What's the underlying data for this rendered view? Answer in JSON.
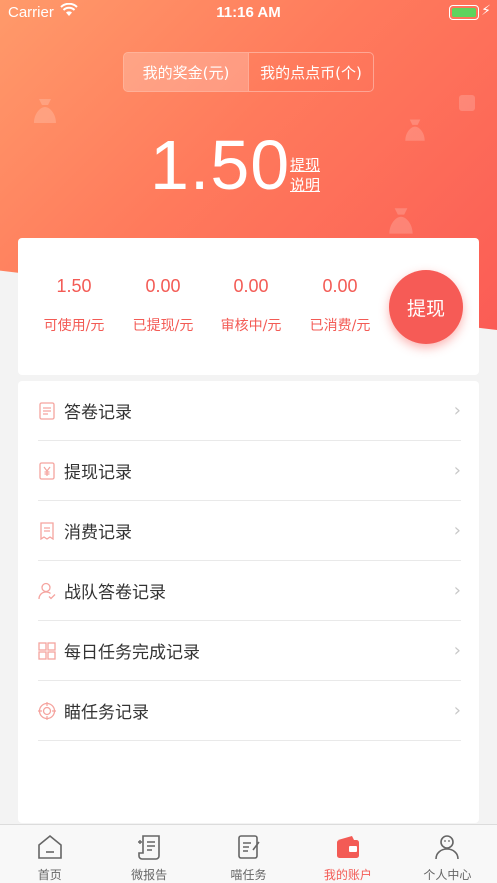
{
  "status_bar": {
    "carrier": "Carrier",
    "time": "11:16 AM"
  },
  "toggle": {
    "bonus_label": "我的奖金(元)",
    "coin_label": "我的点点币(个)"
  },
  "balance": {
    "amount": "1.50",
    "withdraw_link": "提现",
    "explain_link": "说明"
  },
  "stats": [
    {
      "value": "1.50",
      "label": "可使用/元"
    },
    {
      "value": "0.00",
      "label": "已提现/元"
    },
    {
      "value": "0.00",
      "label": "审核中/元"
    },
    {
      "value": "0.00",
      "label": "已消费/元"
    }
  ],
  "withdraw_button": "提现",
  "menu": [
    {
      "label": "答卷记录",
      "icon": "document-icon"
    },
    {
      "label": "提现记录",
      "icon": "yuan-icon"
    },
    {
      "label": "消费记录",
      "icon": "receipt-icon"
    },
    {
      "label": "战队答卷记录",
      "icon": "user-check-icon"
    },
    {
      "label": "每日任务完成记录",
      "icon": "grid-icon"
    },
    {
      "label": "瞄任务记录",
      "icon": "target-icon"
    }
  ],
  "tabs": [
    {
      "label": "首页",
      "icon": "home-icon"
    },
    {
      "label": "微报告",
      "icon": "scroll-icon"
    },
    {
      "label": "喵任务",
      "icon": "edit-icon"
    },
    {
      "label": "我的账户",
      "icon": "wallet-icon"
    },
    {
      "label": "个人中心",
      "icon": "person-icon"
    }
  ],
  "colors": {
    "accent": "#f35b55",
    "hero_start": "#ff9a6a",
    "hero_end": "#fb5c55"
  }
}
